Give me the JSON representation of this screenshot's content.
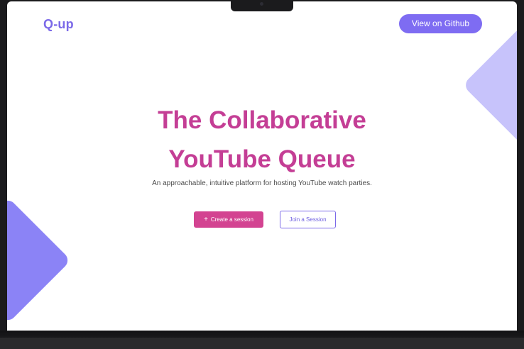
{
  "header": {
    "logo": "Q-up",
    "github_label": "View on Github"
  },
  "hero": {
    "title_line1": "The Collaborative",
    "title_line2": "YouTube Queue",
    "subtitle": "An approachable, intuitive platform for hosting YouTube watch parties."
  },
  "actions": {
    "create_icon": "+",
    "create_label": "Create a session",
    "join_label": "Join a Session"
  },
  "colors": {
    "accent_purple": "#7e6cf2",
    "accent_pink": "#d34391",
    "headline": "#c43e95"
  },
  "icons": {
    "create": "plus-icon"
  }
}
